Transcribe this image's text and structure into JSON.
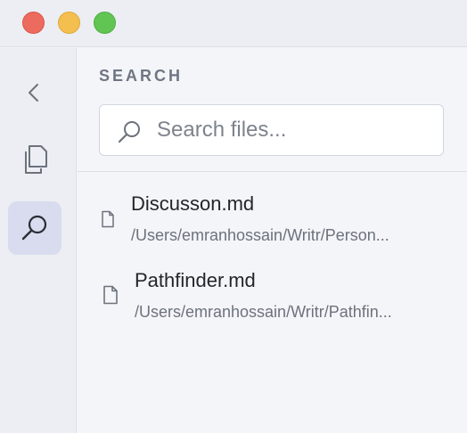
{
  "window": {
    "controls": [
      "close",
      "minimize",
      "maximize"
    ]
  },
  "rail": {
    "items": [
      {
        "icon": "chevron-left-icon",
        "active": false
      },
      {
        "icon": "copy-files-icon",
        "active": false
      },
      {
        "icon": "search-icon",
        "active": true
      }
    ]
  },
  "search": {
    "heading": "SEARCH",
    "placeholder": "Search files..."
  },
  "results": [
    {
      "title": "Discusson.md",
      "path": "/Users/emranhossain/Writr/Person..."
    },
    {
      "title": "Pathfinder.md",
      "path": "/Users/emranhossain/Writr/Pathfin..."
    }
  ],
  "colors": {
    "accent_bg": "#d9dcee",
    "close": "#ed6a5e",
    "minimize": "#f5bf4f",
    "maximize": "#61c554"
  }
}
